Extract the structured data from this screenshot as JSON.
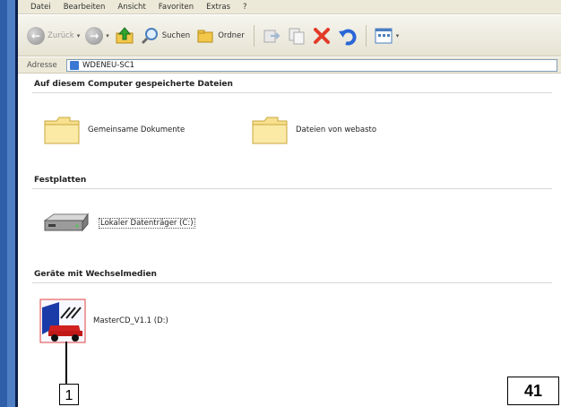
{
  "menu": [
    "Datei",
    "Bearbeiten",
    "Ansicht",
    "Favoriten",
    "Extras",
    "?"
  ],
  "toolbar": {
    "back_label": "Zurück",
    "search_label": "Suchen",
    "folders_label": "Ordner"
  },
  "address": {
    "label": "Adresse",
    "value": "WDENEU-SC1"
  },
  "groups": {
    "computer": {
      "header": "Auf diesem Computer gespeicherte Dateien",
      "items": [
        "Gemeinsame Dokumente",
        "Dateien von webasto"
      ]
    },
    "drives": {
      "header": "Festplatten",
      "items": [
        "Lokaler Datenträger (C:)"
      ]
    },
    "removable": {
      "header": "Geräte mit Wechselmedien",
      "items": [
        "MasterCD_V1.1 (D:)"
      ]
    }
  },
  "callout": "1",
  "page_number": "41",
  "icons": {
    "back": "back-arrow-icon",
    "forward": "forward-arrow-icon",
    "up": "folder-up-icon",
    "search": "search-icon",
    "folders": "folders-icon",
    "move": "move-to-icon",
    "copy": "copy-to-icon",
    "delete": "delete-icon",
    "undo": "undo-icon",
    "views": "views-icon"
  }
}
